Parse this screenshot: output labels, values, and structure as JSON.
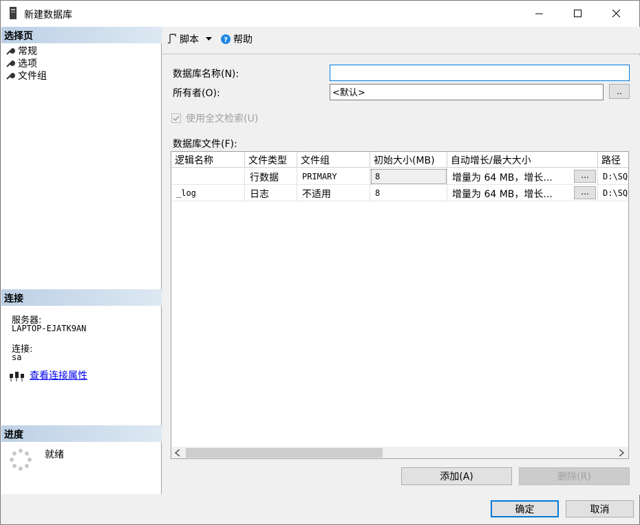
{
  "window": {
    "title": "新建数据库"
  },
  "left_panel": {
    "select_page_header": "选择页",
    "pages": [
      {
        "label": "常规"
      },
      {
        "label": "选项"
      },
      {
        "label": "文件组"
      }
    ],
    "connection_header": "连接",
    "server_label": "服务器:",
    "server_value": "LAPTOP-EJATK9AN",
    "connection_label": "连接:",
    "connection_value": "sa",
    "view_properties_link": "查看连接属性",
    "progress_header": "进度",
    "progress_status": "就绪"
  },
  "toolbar": {
    "script_label": "脚本",
    "help_label": "帮助"
  },
  "form": {
    "db_name_label": "数据库名称(N):",
    "db_name_value": "",
    "owner_label": "所有者(O):",
    "owner_value": "<默认>",
    "browse_label": "..",
    "fulltext_label": "使用全文检索(U)",
    "fulltext_checked": true,
    "db_files_label": "数据库文件(F):"
  },
  "grid": {
    "columns": [
      "逻辑名称",
      "文件类型",
      "文件组",
      "初始大小(MB)",
      "自动增长/最大大小",
      "路径"
    ],
    "rows": [
      {
        "logical_name": "",
        "file_type": "行数据",
        "filegroup": "PRIMARY",
        "initial_size": "8",
        "autogrowth": "增量为 64 MB，增长...",
        "ellipsis": "...",
        "path": "D:\\SQ"
      },
      {
        "logical_name": "_log",
        "file_type": "日志",
        "filegroup": "不适用",
        "initial_size": "8",
        "autogrowth": "增量为 64 MB，增长...",
        "ellipsis": "...",
        "path": "D:\\SQ"
      }
    ]
  },
  "buttons": {
    "add": "添加(A)",
    "remove": "删除(R)",
    "ok": "确定",
    "cancel": "取消"
  },
  "colors": {
    "accent": "#0078d7",
    "section_header": "#bcd0e6",
    "link": "#0000ee"
  }
}
